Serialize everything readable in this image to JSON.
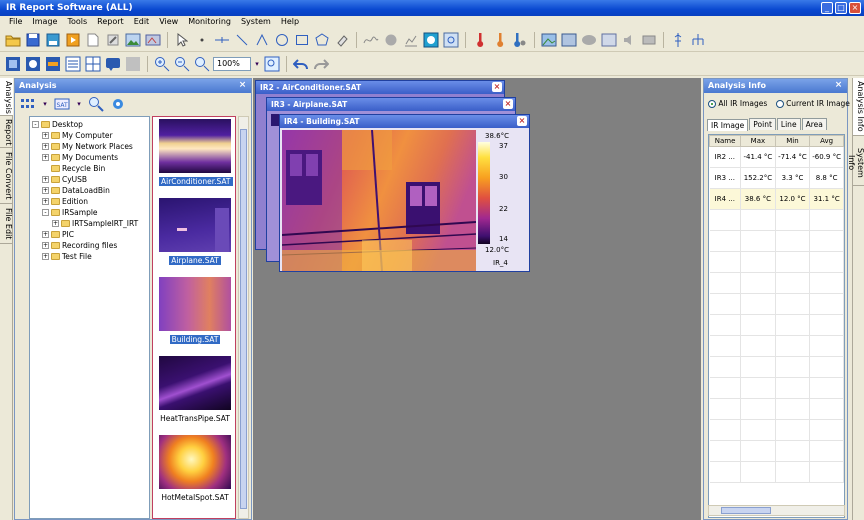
{
  "app": {
    "title": "IR Report Software (ALL)"
  },
  "window_controls": {
    "minimize": "_",
    "maximize": "□",
    "close": "×"
  },
  "menu": [
    "File",
    "Image",
    "Tools",
    "Report",
    "Edit",
    "View",
    "Monitoring",
    "System",
    "Help"
  ],
  "toolbar2": {
    "zoom_value": "100%"
  },
  "left_tabs": [
    "Analysis",
    "Report",
    "File Convert",
    "File Edit"
  ],
  "analysis_panel": {
    "title": "Analysis",
    "tree": [
      {
        "label": "Desktop",
        "level": 0,
        "expander": "-"
      },
      {
        "label": "My Computer",
        "level": 1,
        "expander": "+"
      },
      {
        "label": "My Network Places",
        "level": 1,
        "expander": "+"
      },
      {
        "label": "My Documents",
        "level": 1,
        "expander": "+"
      },
      {
        "label": "Recycle Bin",
        "level": 1,
        "expander": ""
      },
      {
        "label": "CyUSB",
        "level": 1,
        "expander": "+"
      },
      {
        "label": "DataLoadBin",
        "level": 1,
        "expander": "+"
      },
      {
        "label": "Edition",
        "level": 1,
        "expander": "+"
      },
      {
        "label": "IRSample",
        "level": 1,
        "expander": "-"
      },
      {
        "label": "IRTSampleIRT_IRT",
        "level": 2,
        "expander": "+"
      },
      {
        "label": "PIC",
        "level": 1,
        "expander": "+"
      },
      {
        "label": "Recording files",
        "level": 1,
        "expander": "+"
      },
      {
        "label": "Test File",
        "level": 1,
        "expander": "+"
      }
    ],
    "thumbnails": [
      {
        "label": "AirConditioner.SAT",
        "selected": true
      },
      {
        "label": "Airplane.SAT",
        "selected": true
      },
      {
        "label": "Building.SAT",
        "selected": true
      },
      {
        "label": "HeatTransPipe.SAT",
        "selected": false
      },
      {
        "label": "HotMetalSpot.SAT",
        "selected": false
      }
    ]
  },
  "workspace": {
    "windows": [
      {
        "title": "IR2 - AirConditioner.SAT"
      },
      {
        "title": "IR3 - Airplane.SAT"
      },
      {
        "title": "IR4 - Building.SAT"
      }
    ],
    "scale": {
      "max": "38.6°C",
      "ticks": [
        "37",
        "30",
        "22",
        "14"
      ],
      "min": "12.0°C",
      "label": "IR_4"
    }
  },
  "analysis_info": {
    "title": "Analysis Info",
    "radio_all": "All IR Images",
    "radio_current": "Current IR Image",
    "tabs": [
      "IR Image",
      "Point",
      "Line",
      "Area"
    ],
    "columns": [
      "Name",
      "Max",
      "Min",
      "Avg"
    ],
    "rows": [
      [
        "IR2 ...",
        "-41.4 °C",
        "-71.4 °C",
        "-60.9 °C"
      ],
      [
        "IR3 ...",
        "152.2°C",
        "3.3 °C",
        "8.8 °C"
      ],
      [
        "IR4 ...",
        "38.6 °C",
        "12.0 °C",
        "31.1 °C"
      ]
    ]
  },
  "right_tabs": [
    "Analysis Info",
    "System Info"
  ]
}
